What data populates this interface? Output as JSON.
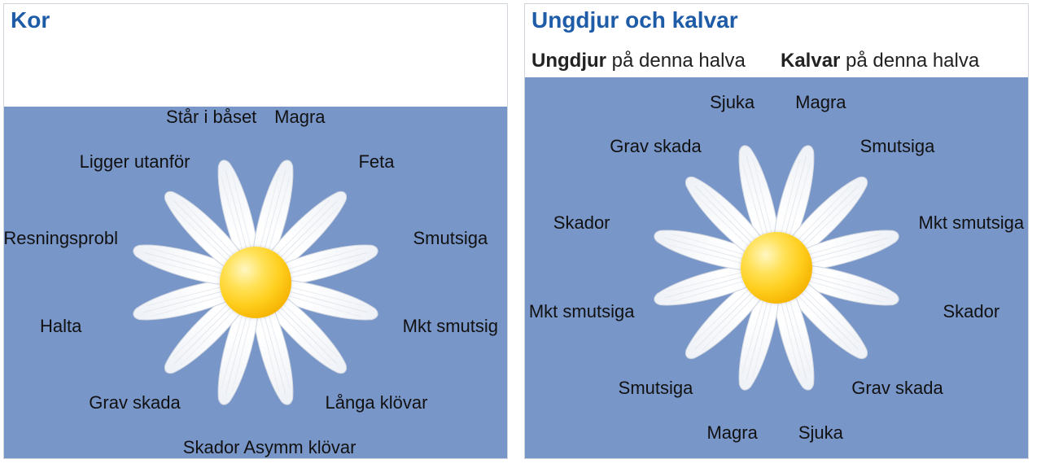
{
  "left": {
    "title": "Kor",
    "petals": [
      "Står i båset",
      "Magra",
      "Feta",
      "Smutsiga",
      "Mkt smutsig",
      "Långa klövar",
      "Asymm klövar",
      "Skador",
      "Grav skada",
      "Halta",
      "Resningsprobl",
      "Ligger utanför"
    ]
  },
  "right": {
    "title": "Ungdjur och kalvar",
    "sub_left_bold": "Ungdjur",
    "sub_left_rest": " på denna halva",
    "sub_right_bold": "Kalvar",
    "sub_right_rest": " på denna halva",
    "petals": [
      "Sjuka",
      "Magra",
      "Smutsiga",
      "Mkt smutsiga",
      "Skador",
      "Grav skada",
      "Sjuka",
      "Magra",
      "Smutsiga",
      "Mkt smutsiga",
      "Skador",
      "Grav skada"
    ]
  }
}
